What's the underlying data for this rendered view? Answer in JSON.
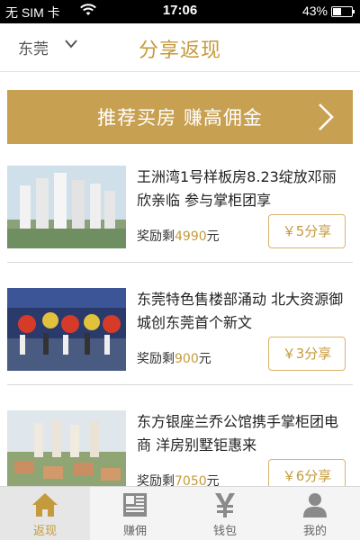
{
  "status_bar": {
    "carrier": "无 SIM 卡",
    "time": "17:06",
    "battery": "43%",
    "battery_level": 0.43
  },
  "nav": {
    "city": "东莞",
    "title": "分享返现"
  },
  "banner": {
    "text": "推荐买房 赚高佣金"
  },
  "items": [
    {
      "title": "王洲湾1号样板房8.23绽放邓丽欣亲临 参与掌柜团享",
      "reward_label": "奖励剩",
      "reward_amount": "4990",
      "reward_unit": "元",
      "share_label": "￥5分享"
    },
    {
      "title": "东莞特色售楼部涌动 北大资源御城创东莞首个新文",
      "reward_label": "奖励剩",
      "reward_amount": "900",
      "reward_unit": "元",
      "share_label": "￥3分享"
    },
    {
      "title": "东方银座兰乔公馆携手掌柜团电商 洋房别墅钜惠来",
      "reward_label": "奖励剩",
      "reward_amount": "7050",
      "reward_unit": "元",
      "share_label": "￥6分享"
    }
  ],
  "tabs": [
    {
      "label": "返现",
      "icon": "home-icon",
      "active": true
    },
    {
      "label": "赚佣",
      "icon": "newspaper-icon",
      "active": false
    },
    {
      "label": "钱包",
      "icon": "yen-icon",
      "active": false
    },
    {
      "label": "我的",
      "icon": "user-icon",
      "active": false
    }
  ],
  "colors": {
    "accent": "#c49a3c",
    "banner": "#c8a052",
    "status_bar": "#000000"
  }
}
